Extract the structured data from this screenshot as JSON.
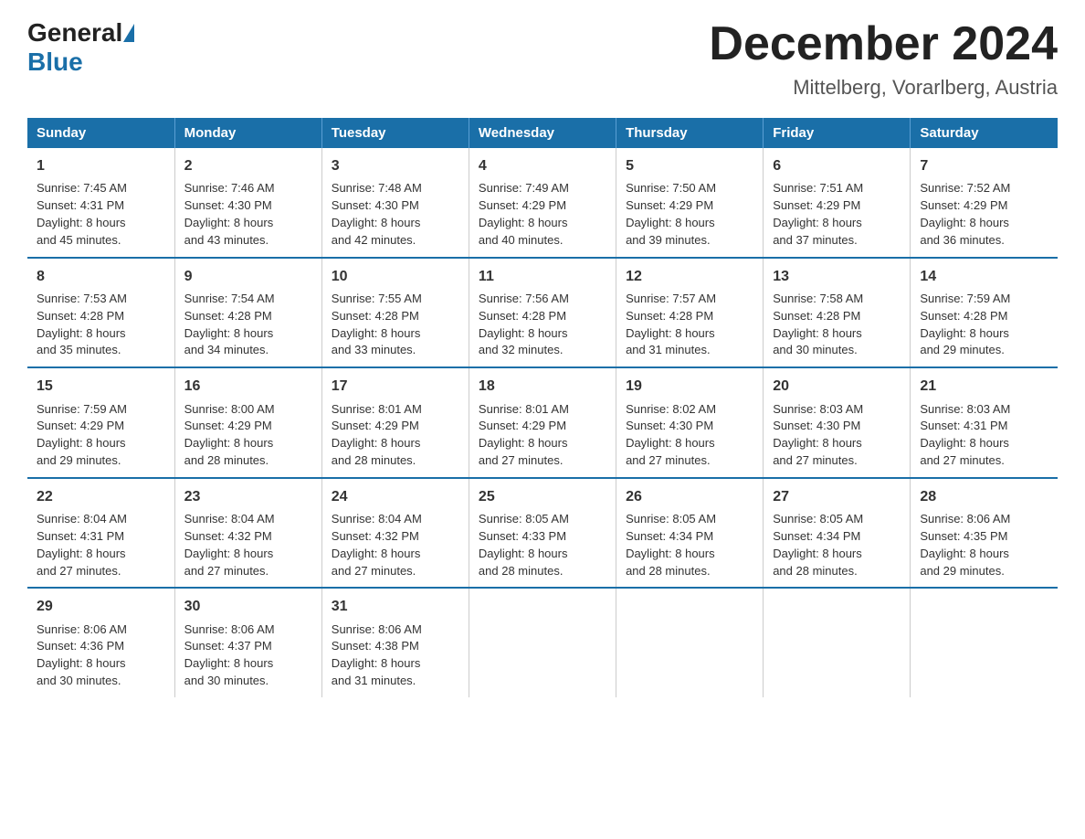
{
  "logo": {
    "general": "General",
    "blue": "Blue"
  },
  "title": "December 2024",
  "subtitle": "Mittelberg, Vorarlberg, Austria",
  "days_of_week": [
    "Sunday",
    "Monday",
    "Tuesday",
    "Wednesday",
    "Thursday",
    "Friday",
    "Saturday"
  ],
  "weeks": [
    [
      {
        "day": "1",
        "info": "Sunrise: 7:45 AM\nSunset: 4:31 PM\nDaylight: 8 hours\nand 45 minutes."
      },
      {
        "day": "2",
        "info": "Sunrise: 7:46 AM\nSunset: 4:30 PM\nDaylight: 8 hours\nand 43 minutes."
      },
      {
        "day": "3",
        "info": "Sunrise: 7:48 AM\nSunset: 4:30 PM\nDaylight: 8 hours\nand 42 minutes."
      },
      {
        "day": "4",
        "info": "Sunrise: 7:49 AM\nSunset: 4:29 PM\nDaylight: 8 hours\nand 40 minutes."
      },
      {
        "day": "5",
        "info": "Sunrise: 7:50 AM\nSunset: 4:29 PM\nDaylight: 8 hours\nand 39 minutes."
      },
      {
        "day": "6",
        "info": "Sunrise: 7:51 AM\nSunset: 4:29 PM\nDaylight: 8 hours\nand 37 minutes."
      },
      {
        "day": "7",
        "info": "Sunrise: 7:52 AM\nSunset: 4:29 PM\nDaylight: 8 hours\nand 36 minutes."
      }
    ],
    [
      {
        "day": "8",
        "info": "Sunrise: 7:53 AM\nSunset: 4:28 PM\nDaylight: 8 hours\nand 35 minutes."
      },
      {
        "day": "9",
        "info": "Sunrise: 7:54 AM\nSunset: 4:28 PM\nDaylight: 8 hours\nand 34 minutes."
      },
      {
        "day": "10",
        "info": "Sunrise: 7:55 AM\nSunset: 4:28 PM\nDaylight: 8 hours\nand 33 minutes."
      },
      {
        "day": "11",
        "info": "Sunrise: 7:56 AM\nSunset: 4:28 PM\nDaylight: 8 hours\nand 32 minutes."
      },
      {
        "day": "12",
        "info": "Sunrise: 7:57 AM\nSunset: 4:28 PM\nDaylight: 8 hours\nand 31 minutes."
      },
      {
        "day": "13",
        "info": "Sunrise: 7:58 AM\nSunset: 4:28 PM\nDaylight: 8 hours\nand 30 minutes."
      },
      {
        "day": "14",
        "info": "Sunrise: 7:59 AM\nSunset: 4:28 PM\nDaylight: 8 hours\nand 29 minutes."
      }
    ],
    [
      {
        "day": "15",
        "info": "Sunrise: 7:59 AM\nSunset: 4:29 PM\nDaylight: 8 hours\nand 29 minutes."
      },
      {
        "day": "16",
        "info": "Sunrise: 8:00 AM\nSunset: 4:29 PM\nDaylight: 8 hours\nand 28 minutes."
      },
      {
        "day": "17",
        "info": "Sunrise: 8:01 AM\nSunset: 4:29 PM\nDaylight: 8 hours\nand 28 minutes."
      },
      {
        "day": "18",
        "info": "Sunrise: 8:01 AM\nSunset: 4:29 PM\nDaylight: 8 hours\nand 27 minutes."
      },
      {
        "day": "19",
        "info": "Sunrise: 8:02 AM\nSunset: 4:30 PM\nDaylight: 8 hours\nand 27 minutes."
      },
      {
        "day": "20",
        "info": "Sunrise: 8:03 AM\nSunset: 4:30 PM\nDaylight: 8 hours\nand 27 minutes."
      },
      {
        "day": "21",
        "info": "Sunrise: 8:03 AM\nSunset: 4:31 PM\nDaylight: 8 hours\nand 27 minutes."
      }
    ],
    [
      {
        "day": "22",
        "info": "Sunrise: 8:04 AM\nSunset: 4:31 PM\nDaylight: 8 hours\nand 27 minutes."
      },
      {
        "day": "23",
        "info": "Sunrise: 8:04 AM\nSunset: 4:32 PM\nDaylight: 8 hours\nand 27 minutes."
      },
      {
        "day": "24",
        "info": "Sunrise: 8:04 AM\nSunset: 4:32 PM\nDaylight: 8 hours\nand 27 minutes."
      },
      {
        "day": "25",
        "info": "Sunrise: 8:05 AM\nSunset: 4:33 PM\nDaylight: 8 hours\nand 28 minutes."
      },
      {
        "day": "26",
        "info": "Sunrise: 8:05 AM\nSunset: 4:34 PM\nDaylight: 8 hours\nand 28 minutes."
      },
      {
        "day": "27",
        "info": "Sunrise: 8:05 AM\nSunset: 4:34 PM\nDaylight: 8 hours\nand 28 minutes."
      },
      {
        "day": "28",
        "info": "Sunrise: 8:06 AM\nSunset: 4:35 PM\nDaylight: 8 hours\nand 29 minutes."
      }
    ],
    [
      {
        "day": "29",
        "info": "Sunrise: 8:06 AM\nSunset: 4:36 PM\nDaylight: 8 hours\nand 30 minutes."
      },
      {
        "day": "30",
        "info": "Sunrise: 8:06 AM\nSunset: 4:37 PM\nDaylight: 8 hours\nand 30 minutes."
      },
      {
        "day": "31",
        "info": "Sunrise: 8:06 AM\nSunset: 4:38 PM\nDaylight: 8 hours\nand 31 minutes."
      },
      {
        "day": "",
        "info": ""
      },
      {
        "day": "",
        "info": ""
      },
      {
        "day": "",
        "info": ""
      },
      {
        "day": "",
        "info": ""
      }
    ]
  ]
}
